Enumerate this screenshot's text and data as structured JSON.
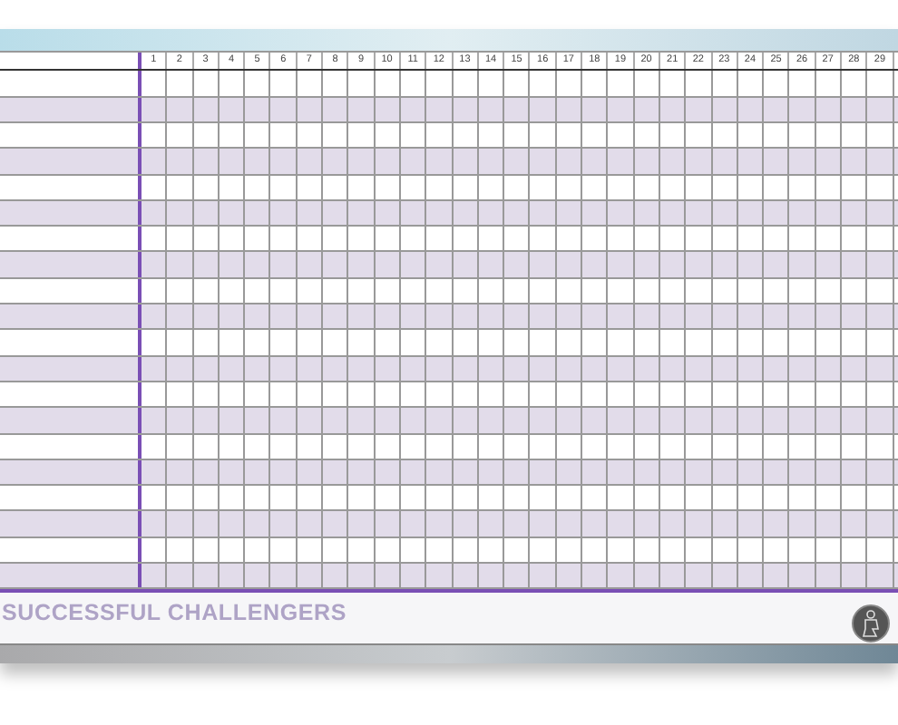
{
  "header": {
    "days": [
      "1",
      "2",
      "3",
      "4",
      "5",
      "6",
      "7",
      "8",
      "9",
      "10",
      "11",
      "12",
      "13",
      "14",
      "15",
      "16",
      "17",
      "18",
      "19",
      "20",
      "21",
      "22",
      "23",
      "24",
      "25",
      "26",
      "27",
      "28",
      "29"
    ]
  },
  "footer": {
    "title": "SUCCESSFUL CHALLENGERS"
  }
}
